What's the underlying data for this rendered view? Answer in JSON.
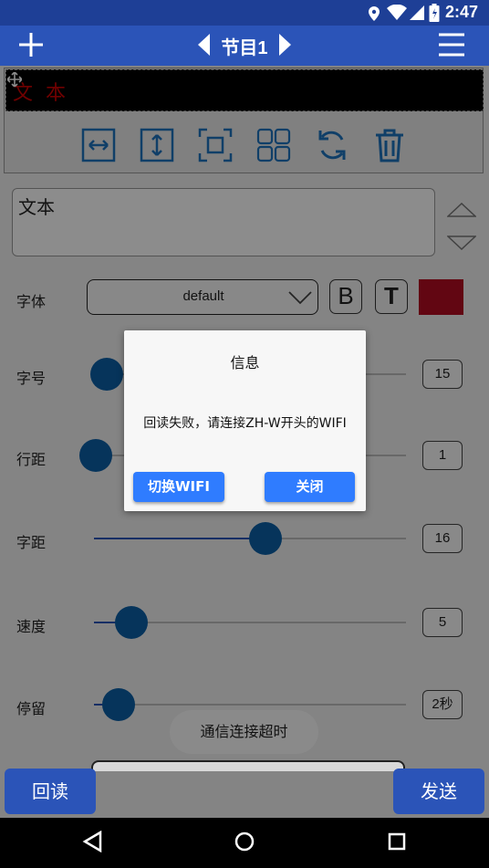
{
  "status_bar": {
    "time": "2:47"
  },
  "title_bar": {
    "title": "节目1",
    "add_icon": "plus-icon",
    "menu_icon": "hamburger-icon"
  },
  "preview": {
    "text": "文本"
  },
  "toolbar": {
    "icons": [
      "fit-width-icon",
      "fit-height-icon",
      "fullscreen-icon",
      "grid-icon",
      "rotate-icon",
      "trash-icon"
    ]
  },
  "text_edit": {
    "value": "文本"
  },
  "font": {
    "label": "字体",
    "value": "default",
    "bold": "B",
    "typeface": "T",
    "color": "#b30b21"
  },
  "sliders": [
    {
      "label": "字号",
      "value": "15",
      "level": 0.04
    },
    {
      "label": "行距",
      "value": "1",
      "level": 0.0
    },
    {
      "label": "字距",
      "value": "16",
      "level": 0.55
    },
    {
      "label": "速度",
      "value": "5",
      "level": 0.12
    },
    {
      "label": "停留",
      "value": "2秒",
      "level": 0.08
    }
  ],
  "dialog": {
    "title": "信息",
    "message": "回读失败，请连接ZH-W开头的WIFI",
    "switch_wifi": "切换WIFI",
    "close": "关闭"
  },
  "toast": {
    "text": "通信连接超时"
  },
  "bottom": {
    "readback": "回读",
    "send": "发送"
  },
  "colors": {
    "primary": "#2b54b8",
    "status_bar": "#1e3f96",
    "thumb": "#0b5fa7",
    "dialog_button": "#2f7cff"
  }
}
